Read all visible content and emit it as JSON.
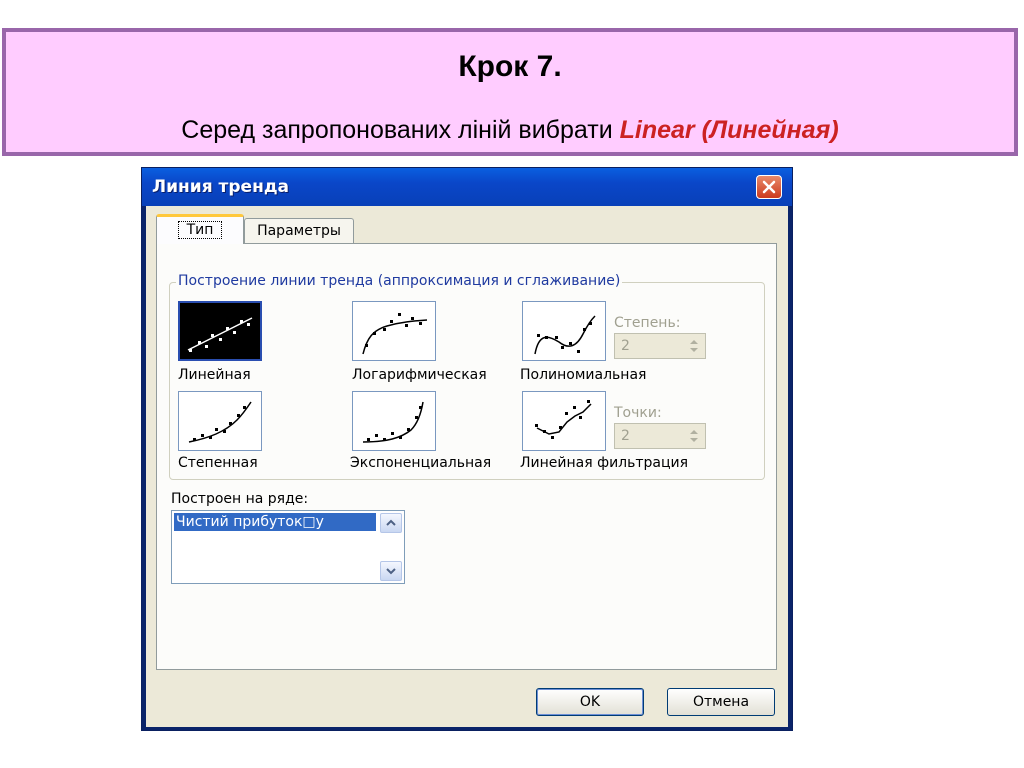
{
  "slide": {
    "title": "Крок 7.",
    "instruction_prefix": "Серед запропонованих ліній  вибрати ",
    "instruction_highlight": "Linear (Линейная)"
  },
  "dialog": {
    "title": "Линия тренда",
    "tabs": [
      {
        "label": "Тип",
        "active": true
      },
      {
        "label": "Параметры",
        "active": false
      }
    ],
    "group_label": "Построение линии тренда (аппроксимация и сглаживание)",
    "trend_types": [
      {
        "label": "Линейная",
        "selected": true,
        "icon": "linear-trend-icon"
      },
      {
        "label": "Логарифмическая",
        "selected": false,
        "icon": "logarithmic-trend-icon"
      },
      {
        "label": "Полиномиальная",
        "selected": false,
        "icon": "polynomial-trend-icon"
      },
      {
        "label": "Степенная",
        "selected": false,
        "icon": "power-trend-icon"
      },
      {
        "label": "Экспоненциальная",
        "selected": false,
        "icon": "exponential-trend-icon"
      },
      {
        "label": "Линейная фильтрация",
        "selected": false,
        "icon": "moving-average-trend-icon"
      }
    ],
    "degree": {
      "label": "Степень:",
      "value": "2",
      "disabled": true
    },
    "period": {
      "label": "Точки:",
      "value": "2",
      "disabled": true
    },
    "series_label": "Построен на ряде:",
    "series_items": [
      "Чистий прибуток□у"
    ],
    "buttons": {
      "ok": "OK",
      "cancel": "Отмена"
    },
    "colors": {
      "titlebar": "#0a46c8",
      "selection": "#316ac5",
      "close": "#cc3a1e"
    }
  }
}
